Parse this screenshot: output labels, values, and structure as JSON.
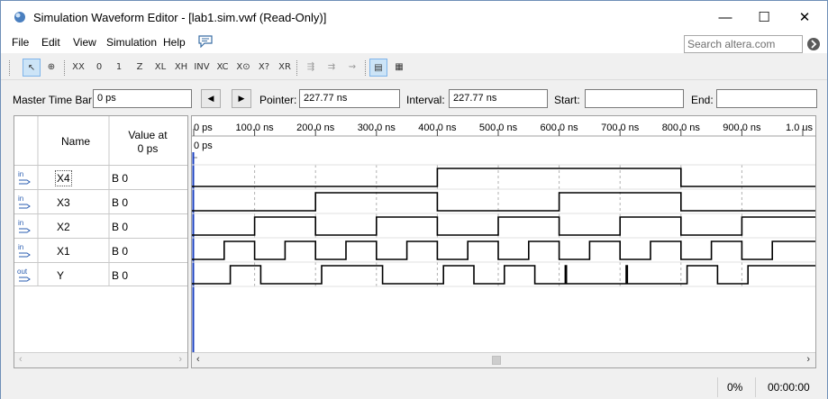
{
  "window": {
    "title": "Simulation Waveform Editor - [lab1.sim.vwf (Read-Only)]",
    "minimize": "—",
    "maximize": "☐",
    "close": "✕"
  },
  "menu": [
    "File",
    "Edit",
    "View",
    "Simulation",
    "Help"
  ],
  "search": {
    "placeholder": "Search altera.com"
  },
  "toolbar_icons": [
    "pointer-tool",
    "zoom-tool",
    "unknown-value",
    "forcing-low",
    "forcing-high",
    "high-impedance",
    "weak-low",
    "weak-high",
    "invert",
    "count-value",
    "forcing-clock",
    "random-value",
    "arbitrary-value",
    "snap-to-grid",
    "overwrite-clock",
    "group-bus",
    "ungroup-bus"
  ],
  "timebar": {
    "master_label": "Master Time Bar:",
    "master_value": "0 ps",
    "prev": "◀",
    "next": "▶",
    "pointer_label": "Pointer:",
    "pointer_value": "227.77 ns",
    "interval_label": "Interval:",
    "interval_value": "227.77 ns",
    "start_label": "Start:",
    "start_value": "",
    "end_label": "End:",
    "end_value": ""
  },
  "table": {
    "name_header": "Name",
    "value_header_1": "Value at",
    "value_header_2": "0 ps",
    "signals": [
      {
        "dir": "in",
        "name": "X4",
        "value": "B 0",
        "transitions_ns": [
          400,
          800
        ]
      },
      {
        "dir": "in",
        "name": "X3",
        "value": "B 0",
        "transitions_ns": [
          200,
          400,
          600,
          800
        ]
      },
      {
        "dir": "in",
        "name": "X2",
        "value": "B 0",
        "transitions_ns": [
          100,
          200,
          300,
          400,
          500,
          600,
          700,
          800,
          900
        ]
      },
      {
        "dir": "in",
        "name": "X1",
        "value": "B 0",
        "transitions_ns": [
          50,
          100,
          150,
          200,
          250,
          300,
          350,
          400,
          450,
          500,
          550,
          600,
          650,
          700,
          750,
          800,
          850,
          900,
          950
        ]
      },
      {
        "dir": "out",
        "name": "Y",
        "value": "B 0",
        "transitions_ns": [
          60,
          110,
          210,
          310,
          410,
          460,
          510,
          560,
          610,
          612,
          710,
          712,
          810,
          860,
          910
        ]
      }
    ]
  },
  "timeline": {
    "ticks": [
      "0 ps",
      "100.0 ns",
      "200.0 ns",
      "300.0 ns",
      "400.0 ns",
      "500.0 ns",
      "600.0 ns",
      "700.0 ns",
      "800.0 ns",
      "900.0 ns",
      "1.0 us"
    ],
    "cursor_label": "0 ps"
  },
  "status": {
    "progress": "0%",
    "elapsed": "00:00:00"
  }
}
